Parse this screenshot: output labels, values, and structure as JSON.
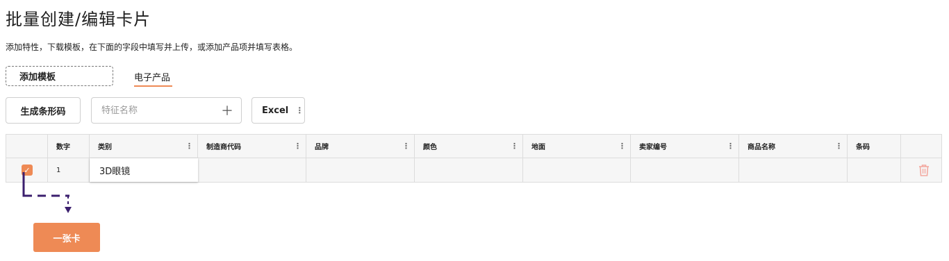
{
  "page": {
    "title": "批量创建/编辑卡片",
    "description": "添加特性，下载模板，在下面的字段中填写并上传，或添加产品项并填写表格。"
  },
  "toolbar": {
    "add_template_label": "添加模板",
    "active_tab_label": "电子产品",
    "generate_barcode_label": "生成条形码",
    "feature_placeholder": "特征名称",
    "excel_label": "Excel"
  },
  "table": {
    "headers": [
      "数字",
      "类别",
      "制造商代码",
      "品牌",
      "颜色",
      "地面",
      "卖家编号",
      "商品名称",
      "条码"
    ],
    "rows": [
      {
        "checked": true,
        "number": "1",
        "category": "3D眼镜",
        "manufacturer_code": "",
        "brand": "",
        "color": "",
        "ground": "",
        "seller_no": "",
        "product_name": "",
        "barcode": ""
      }
    ]
  },
  "callout": {
    "button_label": "一张卡"
  },
  "colors": {
    "accent": "#ee8a55",
    "connector": "#3b1f6e"
  },
  "icons": {
    "plus": "plus-icon",
    "kebab": "kebab-menu-icon",
    "check": "check-icon",
    "trash": "trash-icon",
    "arrow": "arrow-down-icon"
  }
}
